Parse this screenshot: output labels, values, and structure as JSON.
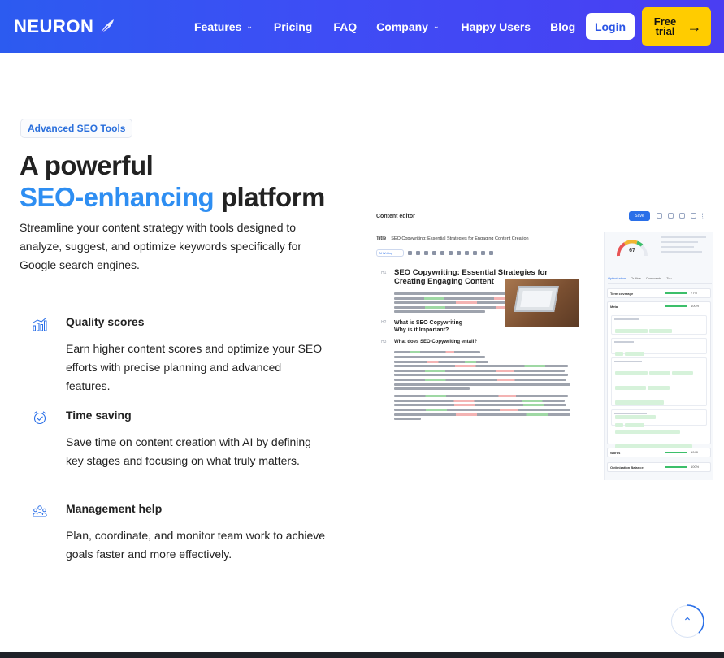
{
  "nav": {
    "logo_text": "NEURON",
    "items": [
      {
        "label": "Features",
        "has_dropdown": true
      },
      {
        "label": "Pricing",
        "has_dropdown": false
      },
      {
        "label": "FAQ",
        "has_dropdown": false
      },
      {
        "label": "Company",
        "has_dropdown": true
      },
      {
        "label": "Happy Users",
        "has_dropdown": false
      },
      {
        "label": "Blog",
        "has_dropdown": false
      }
    ],
    "login_label": "Login",
    "trial_label_line1": "Free",
    "trial_label_line2": "trial",
    "brand_color": "#3a50f2",
    "cta_color": "#ffcc00"
  },
  "hero": {
    "badge": "Advanced SEO Tools",
    "title_line1": "A powerful",
    "title_highlight": "SEO-enhancing",
    "title_rest": "platform",
    "lead": "Streamline your content strategy with tools designed to analyze, suggest, and optimize keywords specifically for Google search engines."
  },
  "features": [
    {
      "icon": "bar-chart-icon",
      "title": "Quality scores",
      "desc": "Earn higher content scores and optimize your SEO efforts with precise planning and advanced features."
    },
    {
      "icon": "alarm-clock-icon",
      "title": "Time saving",
      "desc": "Save time on content creation with AI by defining key stages and focusing on what truly matters."
    },
    {
      "icon": "team-icon",
      "title": "Management help",
      "desc": "Plan, coordinate, and monitor team work to achieve goals faster and more effectively."
    }
  ],
  "editor": {
    "header": "Content editor",
    "save": "Save",
    "title_label": "Title",
    "title_value": "SEO Copywriting: Essential Strategies for Engaging Content Creation",
    "ai_pill": "AI Writing",
    "h1_line1": "SEO Copywriting: Essential Strategies for",
    "h1_line2": "Creating Engaging Content",
    "h2_a_line1": "What is SEO Copywriting",
    "h2_a_line2": "Why is it Important?",
    "h3_a": "What does SEO Copywriting entail?",
    "tag_h1": "H1",
    "tag_h2": "H2",
    "tag_h3": "H3",
    "score": "67",
    "side_tabs": [
      "Optimization",
      "Outline",
      "Comments",
      "Tov"
    ],
    "side_rows": [
      {
        "label": "Term coverage",
        "pct": "77%"
      },
      {
        "label": "Meta",
        "pct": "100%"
      },
      {
        "label": "Words",
        "pct": "1048"
      },
      {
        "label": "Optimization Balance",
        "pct": "100%"
      }
    ]
  },
  "scroll_top": "⌃"
}
